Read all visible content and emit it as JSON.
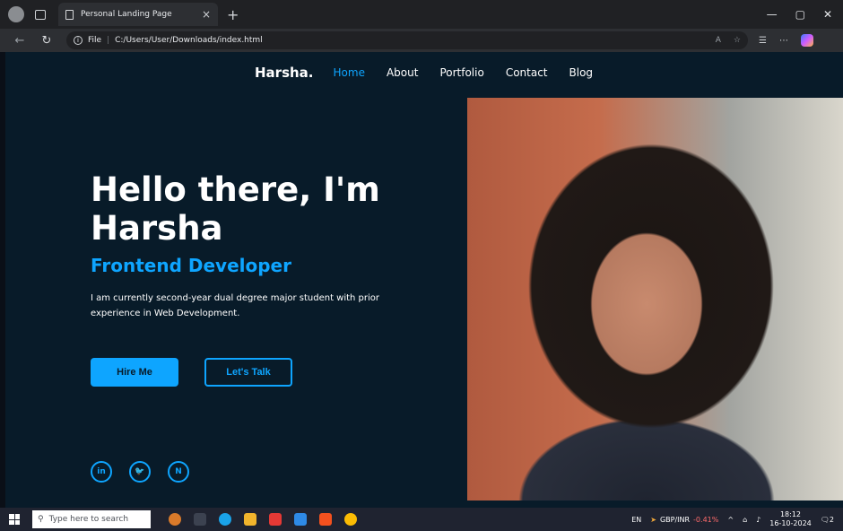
{
  "browser": {
    "tab_title": "Personal Landing Page",
    "tab_close": "×",
    "new_tab": "+",
    "file_label": "File",
    "separator": "|",
    "url": "C:/Users/User/Downloads/index.html",
    "window_controls": [
      "—",
      "▢",
      "✕"
    ]
  },
  "site": {
    "logo": "Harsha.",
    "nav": [
      "Home",
      "About",
      "Portfolio",
      "Contact",
      "Blog"
    ],
    "active_nav": "Home",
    "greeting": "Hello there, I'm Harsha",
    "role": "Frontend Developer",
    "bio": "I am currently second-year dual degree major student with prior experience in Web Development.",
    "buttons": {
      "hire": "Hire Me",
      "talk": "Let's Talk"
    },
    "socials": [
      {
        "icon": "linkedin-icon",
        "glyph": "in"
      },
      {
        "icon": "twitter-icon",
        "glyph": "🐦"
      },
      {
        "icon": "blog-icon",
        "glyph": "N"
      }
    ],
    "accent_color": "#0ea5ff",
    "background_color": "#081b29"
  },
  "taskbar": {
    "search_placeholder": "Type here to search",
    "language": "EN",
    "fx_pair": "GBP/INR",
    "fx_change": "-0.41%",
    "time": "18:12",
    "date": "16-10-2024",
    "notifications": "2"
  }
}
